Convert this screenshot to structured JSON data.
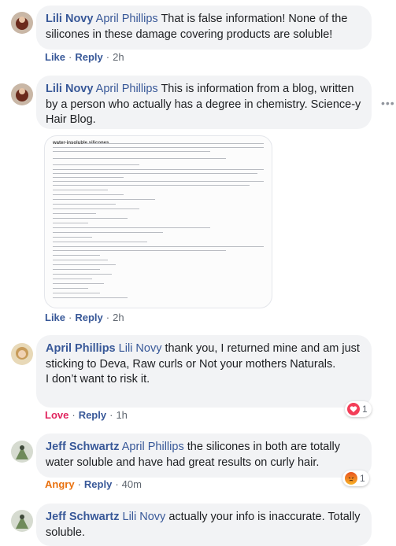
{
  "comments": [
    {
      "author": "Lili Novy",
      "mention": "April Phillips",
      "text": "That is false information! None of the silicones in these damage covering products are soluble!",
      "like": "Like",
      "reply": "Reply",
      "time": "2h"
    },
    {
      "author": "Lili Novy",
      "mention": "April Phillips",
      "text": "This is information from a blog, written by a person who actually has a degree in chemistry. Science-y Hair Blog.",
      "attachment_title": "water-insoluble silicones",
      "like": "Like",
      "reply": "Reply",
      "time": "2h"
    },
    {
      "author": "April Phillips",
      "mention": "Lili Novy",
      "text_line1": "thank you, I returned mine and am just sticking to Deva, Raw curls or Not your mothers Naturals.",
      "text_line2": "I don’t want to risk it.",
      "reaction": "Love",
      "reply": "Reply",
      "time": "1h",
      "reaction_count": "1"
    },
    {
      "author": "Jeff Schwartz",
      "mention": "April Phillips",
      "text": "the silicones in both are totally water soluble and have had great results on curly hair.",
      "reaction": "Angry",
      "reply": "Reply",
      "time": "40m",
      "reaction_count": "1"
    },
    {
      "author": "Jeff Schwartz",
      "mention": "Lili Novy",
      "text": "actually your info is inaccurate. Totally soluble."
    }
  ],
  "separator": "·",
  "colors": {
    "link": "#385898",
    "bubble": "#f2f3f5",
    "love": "#e0245e",
    "angry": "#e9710f"
  }
}
